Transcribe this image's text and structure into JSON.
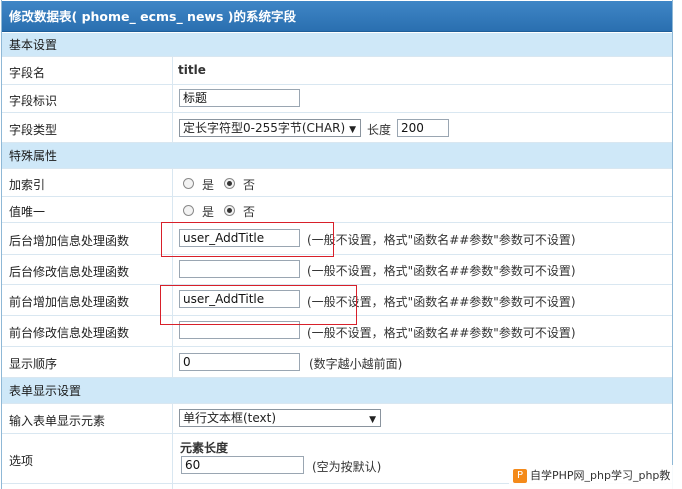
{
  "header": {
    "title": "修改数据表( phome_ ecms_ news )的系统字段"
  },
  "sections": {
    "basic": "基本设置",
    "special": "特殊属性",
    "form": "表单显示设置"
  },
  "fields": {
    "name_label": "字段名",
    "name_value": "title",
    "mark_label": "字段标识",
    "mark_value": "标题",
    "type_label": "字段类型",
    "type_value": "定长字符型0-255字节(CHAR)",
    "length_label": "长度",
    "length_value": "200"
  },
  "special": {
    "index_label": "加索引",
    "unique_label": "值唯一",
    "yes": "是",
    "no": "否",
    "index_selected": "否",
    "unique_selected": "否",
    "add_admin_label": "后台增加信息处理函数",
    "add_admin_value": "user_AddTitle",
    "edit_admin_label": "后台修改信息处理函数",
    "edit_admin_value": "",
    "add_front_label": "前台增加信息处理函数",
    "add_front_value": "user_AddTitle",
    "edit_front_label": "前台修改信息处理函数",
    "edit_front_value": "",
    "func_hint": "(一般不设置，格式\"函数名##参数\"参数可不设置)",
    "order_label": "显示顺序",
    "order_value": "0",
    "order_hint": "(数字越小越前面)"
  },
  "form": {
    "element_label": "输入表单显示元素",
    "element_value": "单行文本框(text)",
    "options_label": "选项",
    "elem_len_label": "元素长度",
    "elem_len_value": "60",
    "elem_len_hint": "(空为按默认)"
  },
  "watermark": {
    "logo": "P",
    "text": "自学PHP网_php学习_php教"
  },
  "colors": {
    "header": "#2f77b9",
    "section": "#cfe8f8",
    "highlight": "#d8202a"
  }
}
